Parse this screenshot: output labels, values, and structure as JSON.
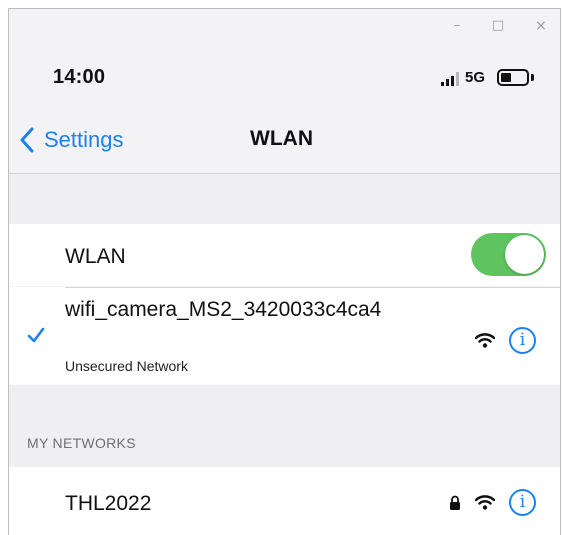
{
  "window": {
    "minimize_glyph": "–",
    "maximize_glyph": "□",
    "close_glyph": "×"
  },
  "status_bar": {
    "time": "14:00",
    "network_type": "5G",
    "icons": [
      "signal-bars-icon",
      "battery-icon"
    ]
  },
  "nav": {
    "back_label": "Settings",
    "title": "WLAN"
  },
  "wlan_toggle": {
    "label": "WLAN",
    "on": true
  },
  "current_network": {
    "name": "wifi_camera_MS2_3420033c4ca4",
    "subtitle": "Unsecured Network",
    "connected": true
  },
  "my_networks": {
    "header": "MY NETWORKS",
    "items": [
      {
        "name": "THL2022",
        "secured": true
      }
    ]
  },
  "colors": {
    "accent": "#1a82f0",
    "toggle_on": "#5fc35f",
    "background": "#f3f3f5",
    "row": "#ffffff"
  }
}
